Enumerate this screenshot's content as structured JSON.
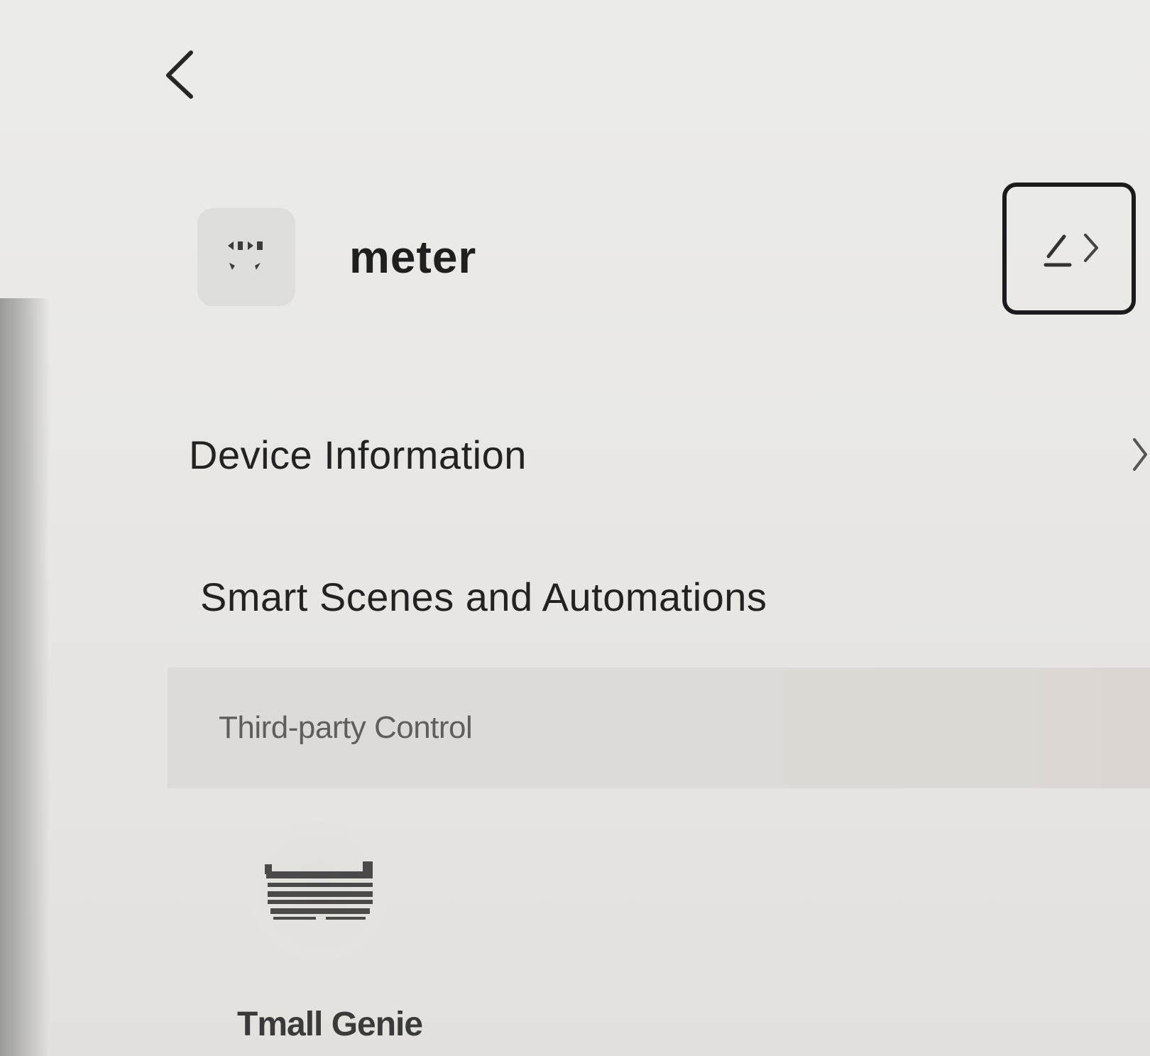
{
  "device": {
    "name": "meter",
    "icon": "socket-icon"
  },
  "menu": {
    "device_information": "Device Information",
    "smart_scenes": "Smart Scenes and Automations"
  },
  "third_party": {
    "section_title": "Third-party Control",
    "items": [
      {
        "label": "Tmall Genie",
        "icon": "tmall-genie-logo"
      }
    ]
  },
  "icons": {
    "back": "chevron-left-icon",
    "edit": "edit-icon",
    "row_arrow": "chevron-right-icon"
  },
  "colors": {
    "background": "#e9e9e7",
    "section_band": "#dcdbd8",
    "text_primary": "#222222",
    "text_secondary": "#5e5e5e"
  }
}
